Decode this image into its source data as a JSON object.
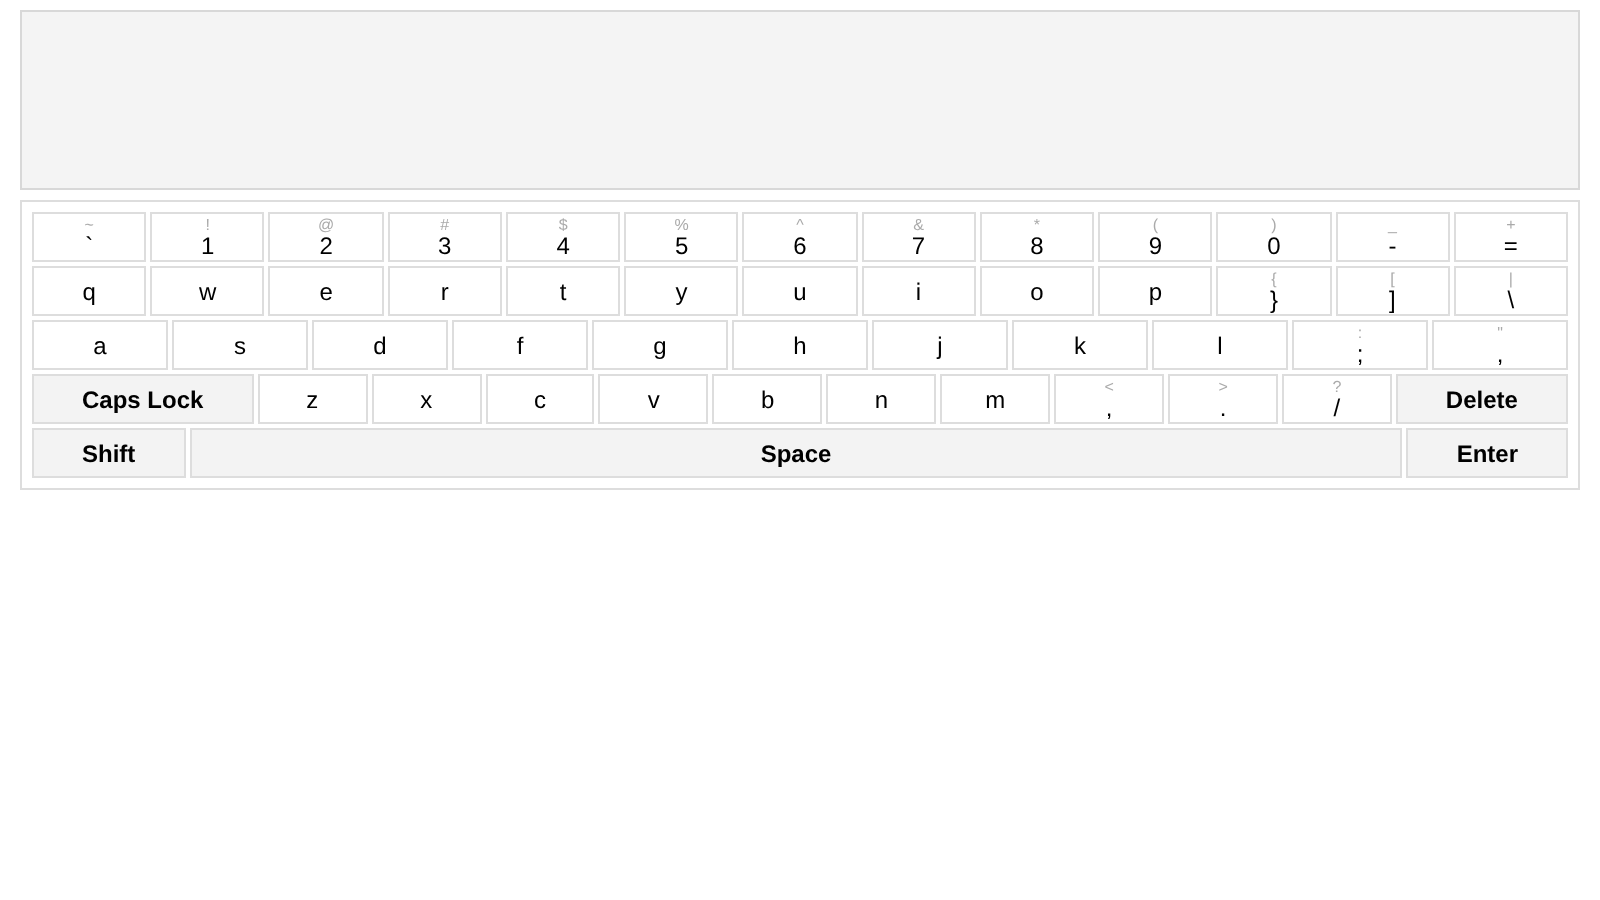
{
  "rows": [
    [
      {
        "kind": "char",
        "shift": "~",
        "main": "`"
      },
      {
        "kind": "char",
        "shift": "!",
        "main": "1"
      },
      {
        "kind": "char",
        "shift": "@",
        "main": "2"
      },
      {
        "kind": "char",
        "shift": "#",
        "main": "3"
      },
      {
        "kind": "char",
        "shift": "$",
        "main": "4"
      },
      {
        "kind": "char",
        "shift": "%",
        "main": "5"
      },
      {
        "kind": "char",
        "shift": "^",
        "main": "6"
      },
      {
        "kind": "char",
        "shift": "&",
        "main": "7"
      },
      {
        "kind": "char",
        "shift": "*",
        "main": "8"
      },
      {
        "kind": "char",
        "shift": "(",
        "main": "9"
      },
      {
        "kind": "char",
        "shift": ")",
        "main": "0"
      },
      {
        "kind": "char",
        "shift": "_",
        "main": "-"
      },
      {
        "kind": "char",
        "shift": "+",
        "main": "="
      }
    ],
    [
      {
        "kind": "char",
        "main": "q"
      },
      {
        "kind": "char",
        "main": "w"
      },
      {
        "kind": "char",
        "main": "e"
      },
      {
        "kind": "char",
        "main": "r"
      },
      {
        "kind": "char",
        "main": "t"
      },
      {
        "kind": "char",
        "main": "y"
      },
      {
        "kind": "char",
        "main": "u"
      },
      {
        "kind": "char",
        "main": "i"
      },
      {
        "kind": "char",
        "main": "o"
      },
      {
        "kind": "char",
        "main": "p"
      },
      {
        "kind": "char",
        "shift": "{",
        "main": "}"
      },
      {
        "kind": "char",
        "shift": "[",
        "main": "]"
      },
      {
        "kind": "char",
        "shift": "|",
        "main": "\\"
      }
    ],
    [
      {
        "kind": "char",
        "main": "a"
      },
      {
        "kind": "char",
        "main": "s"
      },
      {
        "kind": "char",
        "main": "d"
      },
      {
        "kind": "char",
        "main": "f"
      },
      {
        "kind": "char",
        "main": "g"
      },
      {
        "kind": "char",
        "main": "h"
      },
      {
        "kind": "char",
        "main": "j"
      },
      {
        "kind": "char",
        "main": "k"
      },
      {
        "kind": "char",
        "main": "l"
      },
      {
        "kind": "char",
        "shift": ":",
        "main": ";"
      },
      {
        "kind": "char",
        "shift": "\"",
        "main": ","
      }
    ],
    [
      {
        "kind": "modifier",
        "main": "Caps Lock"
      },
      {
        "kind": "char",
        "main": "z"
      },
      {
        "kind": "char",
        "main": "x"
      },
      {
        "kind": "char",
        "main": "c"
      },
      {
        "kind": "char",
        "main": "v"
      },
      {
        "kind": "char",
        "main": "b"
      },
      {
        "kind": "char",
        "main": "n"
      },
      {
        "kind": "char",
        "main": "m"
      },
      {
        "kind": "char",
        "shift": "<",
        "main": ","
      },
      {
        "kind": "char",
        "shift": ">",
        "main": "."
      },
      {
        "kind": "char",
        "shift": "?",
        "main": "/"
      },
      {
        "kind": "modifier",
        "main": "Delete"
      }
    ],
    [
      {
        "kind": "modifier",
        "main": "Shift"
      },
      {
        "kind": "space",
        "main": "Space"
      },
      {
        "kind": "modifier",
        "main": "Enter"
      }
    ]
  ]
}
